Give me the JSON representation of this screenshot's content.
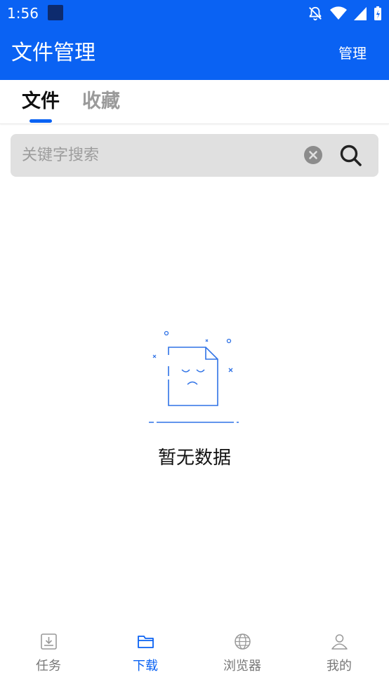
{
  "status_bar": {
    "time": "1:56"
  },
  "app_bar": {
    "title": "文件管理",
    "manage_label": "管理"
  },
  "tabs": [
    {
      "label": "文件",
      "active": true
    },
    {
      "label": "收藏",
      "active": false
    }
  ],
  "search": {
    "placeholder": "关键字搜索",
    "value": ""
  },
  "empty_state": {
    "message": "暂无数据"
  },
  "bottom_nav": {
    "items": [
      {
        "label": "任务",
        "icon": "download-tray-icon",
        "active": false
      },
      {
        "label": "下载",
        "icon": "folder-icon",
        "active": true
      },
      {
        "label": "浏览器",
        "icon": "globe-icon",
        "active": false
      },
      {
        "label": "我的",
        "icon": "person-icon",
        "active": false
      }
    ]
  },
  "colors": {
    "primary": "#0a62f3",
    "inactive": "#777777",
    "search_bg": "#e0e0e0"
  }
}
